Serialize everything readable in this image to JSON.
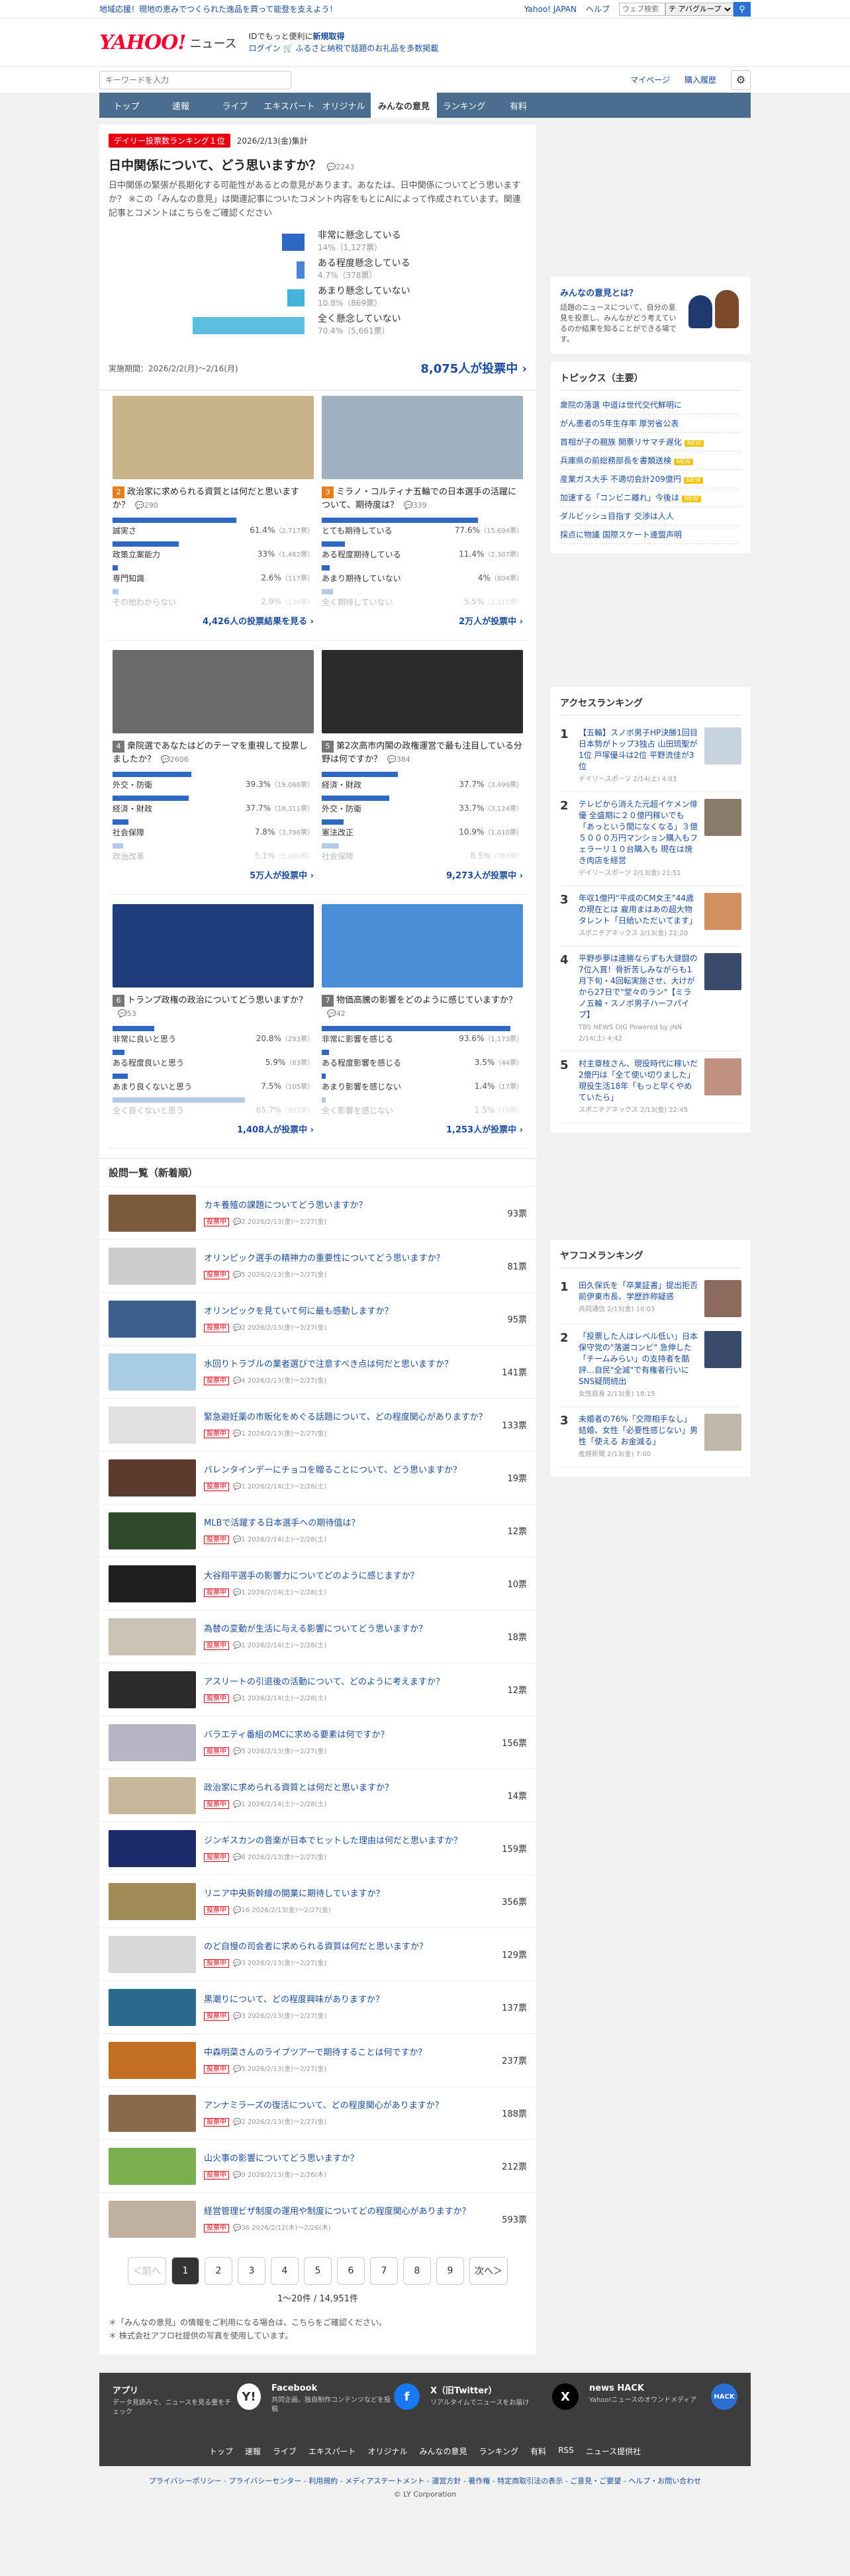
{
  "top": {
    "promo": "地域応援！現地の恵みでつくられた逸品を買って能登を支えよう！",
    "links": [
      "Yahoo! JAPAN",
      "ヘルプ"
    ],
    "search_placeholder": "ウェブ検索",
    "select_value": "テ アバグループ"
  },
  "header": {
    "logo": "YAHOO!",
    "logo_sub": "JAPAN",
    "section": "ニュース",
    "line1": "IDでもっと便利に",
    "line1_link": "新規取得",
    "line2_login": "ログイン",
    "line2_promo": "ふるさと納税で話題のお礼品を多数掲載"
  },
  "searchbar": {
    "placeholder": "キーワードを入力",
    "mypage": "マイページ",
    "history": "購入履歴"
  },
  "nav": [
    "トップ",
    "速報",
    "ライブ",
    "エキスパート",
    "オリジナル",
    "みんなの意見",
    "ランキング",
    "有料"
  ],
  "hero": {
    "badge": "デイリー投票数ランキング１位",
    "date": "2026/2/13(金)集計",
    "title": "日中関係について、どう思いますか？",
    "comments": "2243",
    "desc": "日中関係の緊張が長期化する可能性があるとの意見があります。あなたは、日中関係についてどう思いますか？ ※この「みんなの意見」は関連記事についたコメント内容をもとにAIによって作成されています。関連記事とコメントはこちらをご確認ください",
    "options": [
      {
        "label": "非常に懸念している",
        "pct": "14%（1,127票）",
        "value": 14
      },
      {
        "label": "ある程度懸念している",
        "pct": "4.7%（378票）",
        "value": 4.7
      },
      {
        "label": "あまり懸念していない",
        "pct": "10.8%（869票）",
        "value": 10.8
      },
      {
        "label": "全く懸念していない",
        "pct": "70.4%（5,661票）",
        "value": 70.4
      }
    ],
    "period": "実施期間：2026/2/2(月)〜2/16(月)",
    "total": "8,075人が投票中"
  },
  "cards": [
    {
      "no": "2",
      "title": "政治家に求められる資質とは何だと思いますか？",
      "cm": "290",
      "opts": [
        {
          "l": "誠実さ",
          "p": "61.4%",
          "c": "（2,717票）",
          "v": 61.4
        },
        {
          "l": "政策立案能力",
          "p": "33%",
          "c": "（1,462票）",
          "v": 33
        },
        {
          "l": "専門知識",
          "p": "2.6%",
          "c": "（117票）",
          "v": 2.6
        },
        {
          "l": "その他わからない",
          "p": "2.9%",
          "c": "（130票）",
          "v": 2.9
        }
      ],
      "more": "4,426人の投票結果を見る"
    },
    {
      "no": "3",
      "title": "ミラノ・コルティナ五輪での日本選手の活躍について、期待度は？",
      "cm": "339",
      "opts": [
        {
          "l": "とても期待している",
          "p": "77.6%",
          "c": "（15,694票）",
          "v": 77.6
        },
        {
          "l": "ある程度期待している",
          "p": "11.4%",
          "c": "（2,307票）",
          "v": 11.4
        },
        {
          "l": "あまり期待していない",
          "p": "4%",
          "c": "（804票）",
          "v": 4
        },
        {
          "l": "全く期待していない",
          "p": "5.5%",
          "c": "（1,115票）",
          "v": 5.5
        }
      ],
      "more": "2万人が投票中"
    },
    {
      "no": "4",
      "title": "衆院選であなたはどのテーマを重視して投票しましたか？",
      "cm": "2606",
      "opts": [
        {
          "l": "外交・防衛",
          "p": "39.3%",
          "c": "（19,068票）",
          "v": 39.3
        },
        {
          "l": "経済・財政",
          "p": "37.7%",
          "c": "（18,311票）",
          "v": 37.7
        },
        {
          "l": "社会保障",
          "p": "7.8%",
          "c": "（3,796票）",
          "v": 7.8
        },
        {
          "l": "政治改革",
          "p": "5.1%",
          "c": "（2,480票）",
          "v": 5.1
        }
      ],
      "more": "5万人が投票中"
    },
    {
      "no": "5",
      "title": "第2次高市内閣の政権運営で最も注目している分野は何ですか？",
      "cm": "384",
      "opts": [
        {
          "l": "経済・財政",
          "p": "37.7%",
          "c": "（3,499票）",
          "v": 37.7
        },
        {
          "l": "外交・防衛",
          "p": "33.7%",
          "c": "（3,124票）",
          "v": 33.7
        },
        {
          "l": "憲法改正",
          "p": "10.9%",
          "c": "（1,010票）",
          "v": 10.9
        },
        {
          "l": "社会保障",
          "p": "8.5%",
          "c": "（787票）",
          "v": 8.5
        }
      ],
      "more": "9,273人が投票中"
    },
    {
      "no": "6",
      "title": "トランプ政権の政治についてどう思いますか？",
      "cm": "53",
      "opts": [
        {
          "l": "非常に良いと思う",
          "p": "20.8%",
          "c": "（293票）",
          "v": 20.8
        },
        {
          "l": "ある程度良いと思う",
          "p": "5.9%",
          "c": "（83票）",
          "v": 5.9
        },
        {
          "l": "あまり良くないと思う",
          "p": "7.5%",
          "c": "（105票）",
          "v": 7.5
        },
        {
          "l": "全く良くないと思う",
          "p": "65.7%",
          "c": "（927票）",
          "v": 65.7
        }
      ],
      "more": "1,408人が投票中"
    },
    {
      "no": "7",
      "title": "物価高騰の影響をどのように感じていますか？",
      "cm": "42",
      "opts": [
        {
          "l": "非常に影響を感じる",
          "p": "93.6%",
          "c": "（1,173票）",
          "v": 93.6
        },
        {
          "l": "ある程度影響を感じる",
          "p": "3.5%",
          "c": "（44票）",
          "v": 3.5
        },
        {
          "l": "あまり影響を感じない",
          "p": "1.4%",
          "c": "（17票）",
          "v": 1.4
        },
        {
          "l": "全く影響を感じない",
          "p": "1.5%",
          "c": "（19票）",
          "v": 1.5
        }
      ],
      "more": "1,253人が投票中"
    }
  ],
  "list_title": "設問一覧（新着順）",
  "list": [
    {
      "t": "カキ養殖の課題についてどう思いますか？",
      "m": "2026/2/13(金)〜2/27(金)",
      "c": "2",
      "v": "93票",
      "col": "#7a5a3a"
    },
    {
      "t": "オリンピック選手の精神力の重要性についてどう思いますか？",
      "m": "2026/2/13(金)〜2/27(金)",
      "c": "5",
      "v": "81票",
      "col": "#cccccc"
    },
    {
      "t": "オリンピックを見ていて何に最も感動しますか？",
      "m": "2026/2/13(金)〜2/27(金)",
      "c": "2",
      "v": "95票",
      "col": "#3a5f8a"
    },
    {
      "t": "水回りトラブルの業者選びで注意すべき点は何だと思いますか？",
      "m": "2026/2/13(金)〜2/27(金)",
      "c": "4",
      "v": "141票",
      "col": "#a8cde3"
    },
    {
      "t": "緊急避妊薬の市販化をめぐる話題について、どの程度関心がありますか？",
      "m": "2026/2/13(金)〜2/27(金)",
      "c": "1",
      "v": "133票",
      "col": "#e0e0e0"
    },
    {
      "t": "バレンタインデーにチョコを贈ることについて、どう思いますか？",
      "m": "2026/2/14(土)〜2/28(土)",
      "c": "1",
      "v": "19票",
      "col": "#5a3b2e"
    },
    {
      "t": "MLBで活躍する日本選手への期待值は？",
      "m": "2026/2/14(土)〜2/28(土)",
      "c": "1",
      "v": "12票",
      "col": "#2f4a2a"
    },
    {
      "t": "大谷翔平選手の影響力についてどのように感じますか？",
      "m": "2026/2/14(土)〜2/28(土)",
      "c": "1",
      "v": "10票",
      "col": "#1f1f1f"
    },
    {
      "t": "為替の変動が生活に与える影響についてどう思いますか？",
      "m": "2026/2/14(土)〜2/28(土)",
      "c": "1",
      "v": "18票",
      "col": "#c9c2b5"
    },
    {
      "t": "アスリートの引退後の活動について、どのように考えますか？",
      "m": "2026/2/14(土)〜2/28(土)",
      "c": "1",
      "v": "12票",
      "col": "#2a2a2a"
    },
    {
      "t": "バラエティ番組のMCに求める要素は何ですか？",
      "m": "2026/2/13(金)〜2/27(金)",
      "c": "5",
      "v": "156票",
      "col": "#b5b5c5"
    },
    {
      "t": "政治家に求められる資質とは何だと思いますか？",
      "m": "2026/2/14(土)〜2/28(土)",
      "c": "1",
      "v": "14票",
      "col": "#c8b89a"
    },
    {
      "t": "ジンギスカンの音楽が日本でヒットした理由は何だと思いますか？",
      "m": "2026/2/13(金)〜2/27(金)",
      "c": "6",
      "v": "159票",
      "col": "#1a2a6a"
    },
    {
      "t": "リニア中央新幹線の開業に期待していますか？",
      "m": "2026/2/13(金)〜2/27(金)",
      "c": "16",
      "v": "356票",
      "col": "#a08a55"
    },
    {
      "t": "のど自慢の司会者に求められる資質は何だと思いますか？",
      "m": "2026/2/13(金)〜2/27(金)",
      "c": "3",
      "v": "129票",
      "col": "#d8d8d8"
    },
    {
      "t": "黒潮りについて、どの程度興味がありますか？",
      "m": "2026/2/13(金)〜2/27(金)",
      "c": "3",
      "v": "137票",
      "col": "#2a6a8a"
    },
    {
      "t": "中森明菜さんのライブツアーで期待することは何ですか？",
      "m": "2026/2/13(金)〜2/27(金)",
      "c": "5",
      "v": "237票",
      "col": "#c07020"
    },
    {
      "t": "アンナミラーズの復活について、どの程度関心がありますか？",
      "m": "2026/2/13(金)〜2/27(金)",
      "c": "2",
      "v": "188票",
      "col": "#8a6a4a"
    },
    {
      "t": "山火事の影響についてどう思いますか？",
      "m": "2026/2/13(金)〜2/26(木)",
      "c": "9",
      "v": "212票",
      "col": "#7ab050"
    },
    {
      "t": "経営管理ビザ制度の運用や制度についてどの程度関心がありますか？",
      "m": "2026/2/12(木)〜2/26(木)",
      "c": "36",
      "v": "593票",
      "col": "#c0b0a0"
    }
  ],
  "pager": {
    "prev": "＜前へ",
    "pages": [
      "1",
      "2",
      "3",
      "4",
      "5",
      "6",
      "7",
      "8",
      "9"
    ],
    "next": "次へ＞",
    "count": "1〜20件 / 14,951件"
  },
  "notes": [
    "＊「みんなの意見」の情報をご利用になる場合は、こちらをご確認ください。",
    "＊ 株式会社アフロ社提供の写真を使用しています。"
  ],
  "side": {
    "mascot_title": "みんなの意見とは？",
    "mascot_desc": "話題のニュースについて、自分の意見を投票し、みんながどう考えているのか結果を知ることができる場です。",
    "topics_title": "トピックス（主要）",
    "topics": [
      {
        "t": "衆院の落選 中道は世代交代鮮明に",
        "n": false
      },
      {
        "t": "がん患者の5年生存率 厚労省公表",
        "n": false
      },
      {
        "t": "首相が子の親族 開票リサマチ遅化",
        "n": true
      },
      {
        "t": "兵庫県の前総務部長を書類送検",
        "n": true
      },
      {
        "t": "産業ガス大手 不適切会計209億円",
        "n": true
      },
      {
        "t": "加速する「コンビニ離れ」今後は",
        "n": true
      },
      {
        "t": "ダルビッシュ目指す 交渉は人人",
        "n": false
      },
      {
        "t": "採点に物議 国際スケート連盟声明",
        "n": false
      }
    ],
    "access_title": "アクセスランキング",
    "access": [
      {
        "t": "【五輪】スノボ男子HP決勝1回目日本勢がトップ3独占 山田琉聖が1位 戸塚優斗は2位 平野流佳が3位",
        "s": "デイリースポーツ 2/14(土) 4:03",
        "col": "#c7d4e0"
      },
      {
        "t": "テレビから消えた元超イケメン俳優 全盛期に２０億円稼いでも「あっという間になくなる」３億５０００万円マンション購入もフェラーリ１０台購入も 現在は焼き肉店を経営",
        "s": "デイリースポーツ 2/13(金) 21:51",
        "col": "#8a7a6a"
      },
      {
        "t": "年収1億円“平成のCM女王”44歳の現在とは 雇用まはあの超大物タレント「日給いただいてます」",
        "s": "スポニチアネックス 2/13(金) 22:20",
        "col": "#d09060"
      },
      {
        "t": "平野歩夢は連勝ならずも大健闘の7位入賞！骨折苦しみながらも1月下旬・4回転実施させ、大けがから27日で\"堂々のラン\"【ミラノ五輪・スノボ男子ハーフパイプ】",
        "s": "TBS NEWS DIG Powered by JNN 2/14(土) 4:42",
        "col": "#3a4a6a"
      },
      {
        "t": "村主章枝さん、現役時代に稼いだ2億円は「全て使い切りました」 現役生活18年「もっと早くやめていたら」",
        "s": "スポニチアネックス 2/13(金) 22:45",
        "col": "#c09080"
      }
    ],
    "yafoko_title": "ヤフコメランキング",
    "yafoko": [
      {
        "t": "田久保氏を「卒業証書」提出拒否 前伊東市長、学歴詐称疑惑",
        "s": "共同通信 2/13(金) 10:03",
        "col": "#8a6a5a"
      },
      {
        "t": "「投票した人はレベル低い」日本保守党の\"落選コンビ\" 急伸した「チームみらい」の支持者を酷評…自民\"全滅\"で有権者行いに SNS疑問続出",
        "s": "女性自身 2/13(金) 18:15",
        "col": "#3a4a6a"
      },
      {
        "t": "未婚者の76%「交際相手なし」結婚、女性「必要性感じない」男性「使える お金減る」",
        "s": "産経新聞 2/13(金) 7:00",
        "col": "#c0b8a8"
      }
    ]
  },
  "footer": {
    "cols": [
      {
        "t": "アプリ",
        "d": "データ見読みで、ニュースを見る量をチェック"
      },
      {
        "t": "Facebook",
        "d": "共同企画、独自制作コンテンツなどを投稿"
      },
      {
        "t": "X（旧Twitter）",
        "d": "リアルタイムでニュースをお届け"
      },
      {
        "t": "news HACK",
        "d": "Yahoo!ニュースのオウンドメディア"
      }
    ],
    "links": [
      "トップ",
      "速報",
      "ライブ",
      "エキスパート",
      "オリジナル",
      "みんなの意見",
      "ランキング",
      "有料",
      "RSS",
      "ニュース提供社"
    ],
    "legal": "プライバシーポリシー - プライバシーセンター - 利用規約 - メディアステートメント - 運営方針 - 著作権 - 特定商取引法の表示 - ご意見・ご要望 - ヘルプ・お問い合わせ",
    "copy": "© LY Corporation"
  },
  "colors": {
    "accent": "#2e68c2",
    "nav": "#4b6e8e",
    "brand": "#ff0033"
  }
}
